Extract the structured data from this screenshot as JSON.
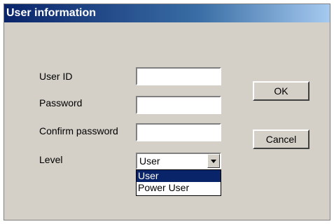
{
  "window": {
    "title": "User information"
  },
  "form": {
    "user_id_label": "User ID",
    "password_label": "Password",
    "confirm_password_label": "Confirm password",
    "level_label": "Level",
    "user_id_value": "",
    "password_value": "",
    "confirm_password_value": ""
  },
  "level_select": {
    "selected": "User",
    "options": [
      "User",
      "Power User"
    ]
  },
  "buttons": {
    "ok": "OK",
    "cancel": "Cancel"
  },
  "colors": {
    "titlebar_start": "#0a246a",
    "titlebar_end": "#a6caf0",
    "dialog_face": "#d4d0c8",
    "selection": "#0a246a"
  },
  "icons": {
    "dropdown": "chevron-down-icon"
  }
}
